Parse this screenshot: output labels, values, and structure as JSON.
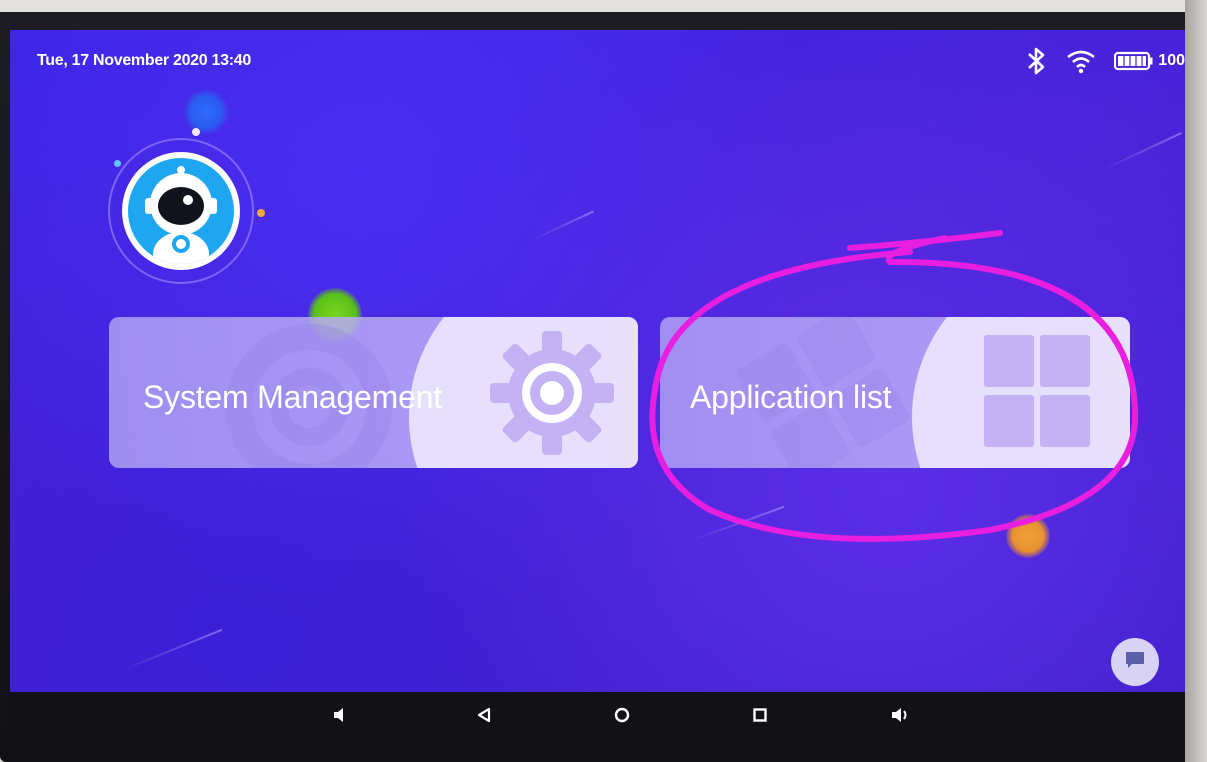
{
  "status_bar": {
    "datetime": "Tue, 17 November 2020 13:40",
    "battery_label": "100",
    "icons": [
      "bluetooth-icon",
      "wifi-icon",
      "battery-icon"
    ]
  },
  "avatar": {
    "icon": "astronaut-avatar-icon"
  },
  "tiles": {
    "system": {
      "label": "System Management",
      "icon": "gear-icon"
    },
    "apps": {
      "label": "Application list",
      "icon": "grid-icon"
    }
  },
  "annotation": {
    "description_color": "#e81fe0"
  },
  "navbar": {
    "icons": [
      "volume-down-icon",
      "back-icon",
      "home-icon",
      "recents-icon",
      "volume-up-icon"
    ]
  },
  "chat_button": {
    "icon": "chat-icon"
  },
  "colors": {
    "screen_bg": "#3f24e0",
    "tile_bg": "#b4a4f2",
    "tile_accent": "#ece8fb",
    "icon_fill": "#c7b6f5",
    "highlight": "#e81fe0",
    "navbar_bg": "#121216"
  }
}
